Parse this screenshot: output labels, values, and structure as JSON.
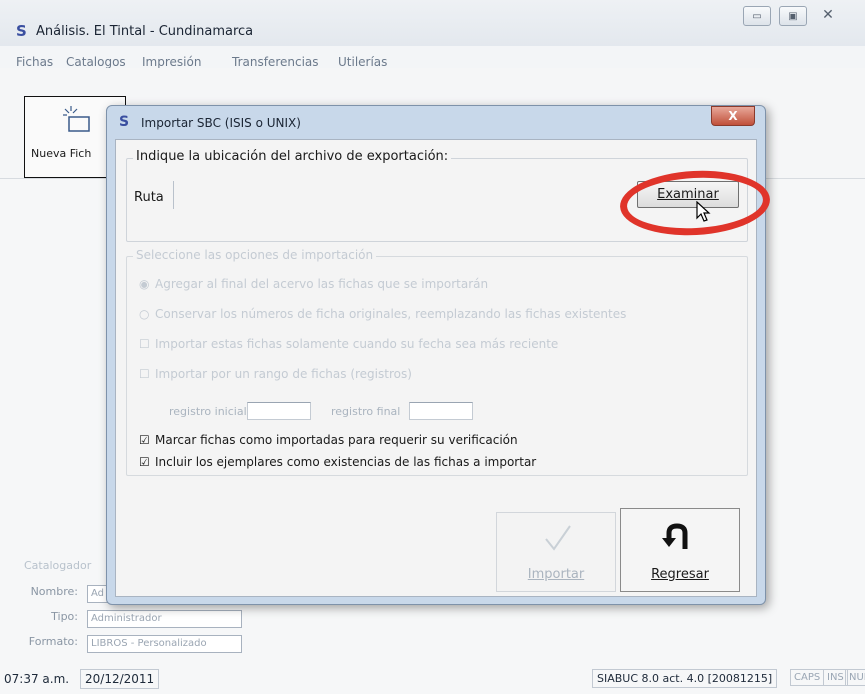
{
  "main_window": {
    "logo": "S",
    "title": "Análisis. El Tintal - Cundinamarca",
    "controls": {
      "minimize": "▭",
      "maximize": "▣",
      "close": "✕"
    }
  },
  "menu": [
    "Fichas",
    "Catalogos",
    "Impresión",
    "Transferencias",
    "Utilerías"
  ],
  "toolbar": {
    "nueva_label": "Nueva Fich"
  },
  "catalogador": {
    "legend": "Catalogador",
    "nombre_label": "Nombre:",
    "nombre_value": "Ad",
    "tipo_label": "Tipo:",
    "tipo_value": "Administrador",
    "formato_label": "Formato:",
    "formato_value": "LIBROS - Personalizado"
  },
  "status": {
    "time": "07:37 a.m.",
    "date": "20/12/2011",
    "version": "SIABUC 8.0 act. 4.0 [20081215]",
    "caps": "CAPS",
    "ins": "INS",
    "num": "NUM"
  },
  "dialog": {
    "logo": "S",
    "title": "Importar SBC (ISIS o UNIX)",
    "close": "X",
    "location_group_title": "Indique la ubicación del archivo de exportación:",
    "ruta_label": "Ruta",
    "ruta_value": "",
    "examinar_label": "Examinar",
    "options_group_title": "Seleccione las opciones de importación",
    "options": [
      {
        "label": "Agregar al final del acervo las fichas que se importarán",
        "mark": "◉",
        "active": false
      },
      {
        "label": "Conservar los números de ficha originales, reemplazando las fichas existentes",
        "mark": "○",
        "active": false
      },
      {
        "label": "Importar estas fichas solamente cuando su fecha sea más reciente",
        "mark": "☐",
        "active": false
      },
      {
        "label": "Importar por un rango de fichas (registros)",
        "mark": "☐",
        "active": false
      },
      {
        "label": "Marcar fichas como importadas para requerir su verificación",
        "mark": "☑",
        "active": true
      },
      {
        "label": "Incluir los ejemplares como existencias de las fichas a importar",
        "mark": "☑",
        "active": true
      }
    ],
    "registro_inicial_label": "registro inicial",
    "registro_final_label": "registro final",
    "importar_label": "Importar",
    "regresar_label": "Regresar"
  }
}
